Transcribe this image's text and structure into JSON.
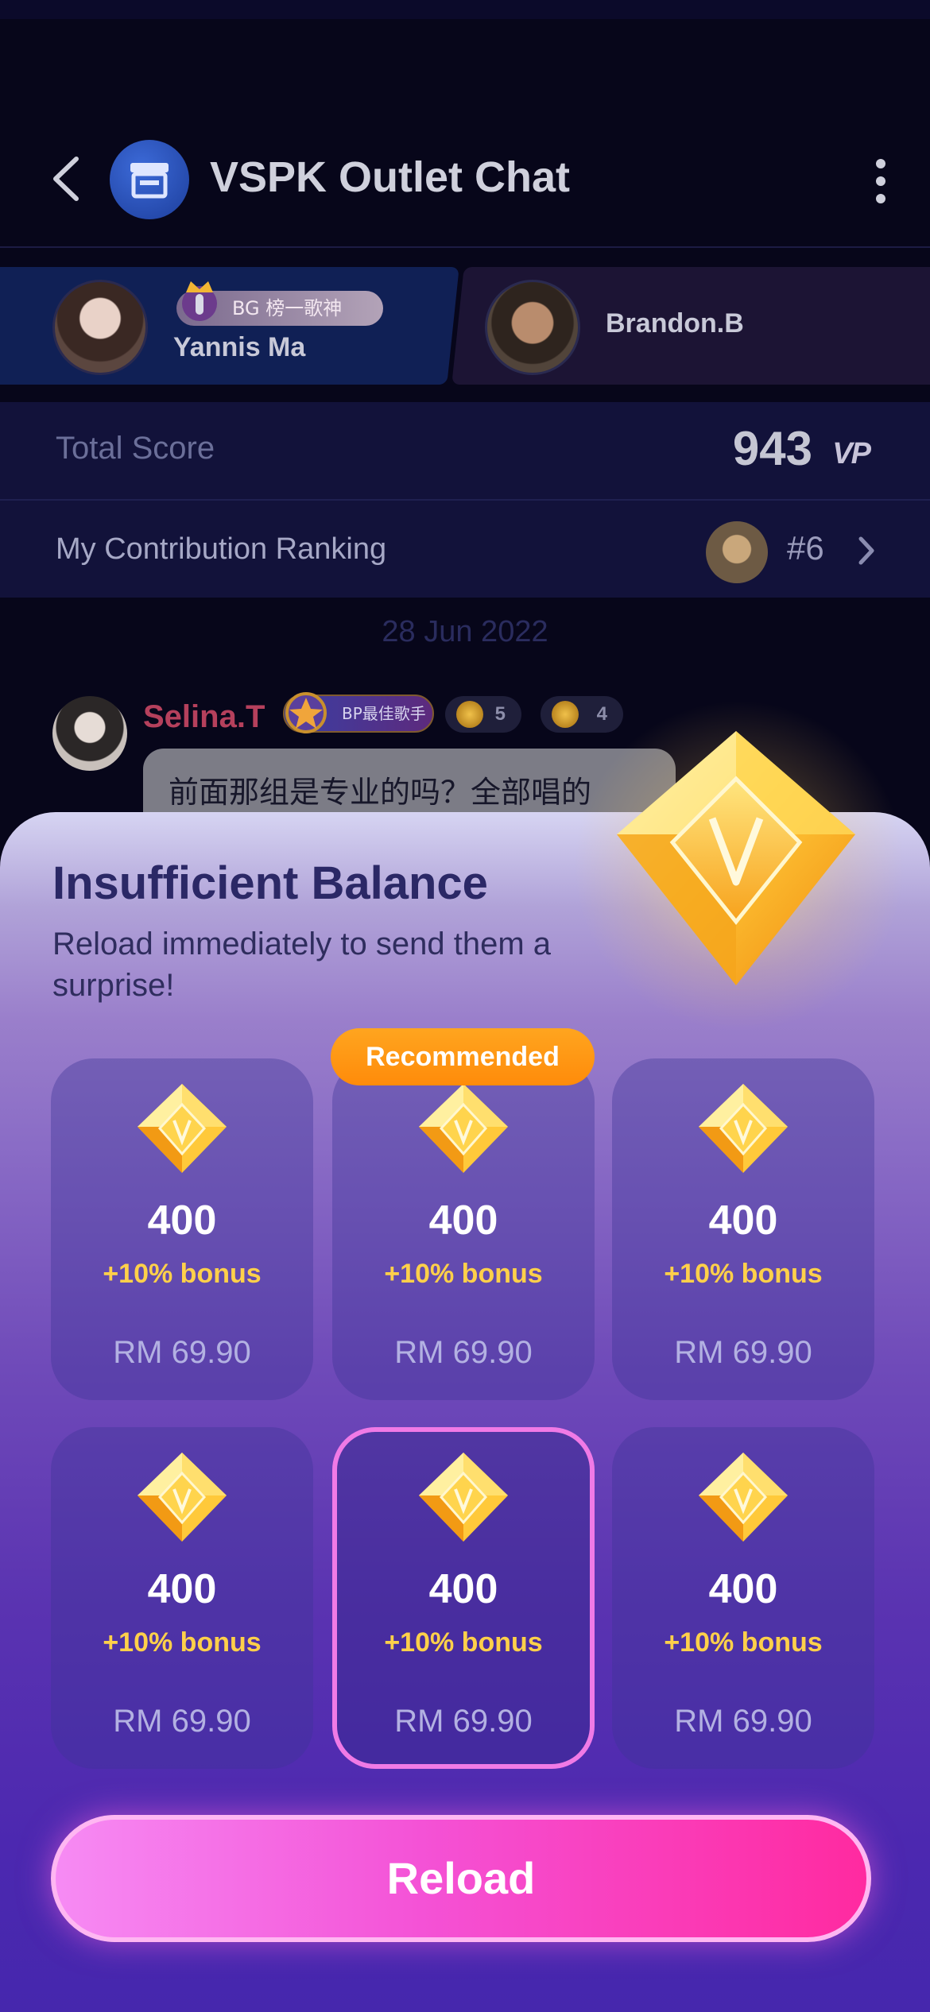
{
  "header": {
    "title": "VSPK Outlet Chat"
  },
  "singers": {
    "left": {
      "name": "Yannis Ma",
      "badge": "BG 榜一歌神"
    },
    "right": {
      "name": "Brandon.B"
    }
  },
  "score": {
    "label": "Total Score",
    "value": "943",
    "unit_logo": "VP"
  },
  "ranking": {
    "label": "My Contribution Ranking",
    "value": "#6"
  },
  "chat": {
    "date": "28 Jun 2022",
    "message": {
      "sender": "Selina.T",
      "badge": "BP最佳歌手",
      "level_a": "5",
      "level_b": "4",
      "text": "前面那组是专业的吗？全部唱的"
    }
  },
  "sheet": {
    "title": "Insufficient Balance",
    "subtitle": "Reload immediately to send them a surprise!",
    "recommended_label": "Recommended",
    "packages": [
      {
        "amount": "400",
        "bonus": "+10% bonus",
        "price": "RM 69.90"
      },
      {
        "amount": "400",
        "bonus": "+10% bonus",
        "price": "RM 69.90"
      },
      {
        "amount": "400",
        "bonus": "+10% bonus",
        "price": "RM 69.90"
      },
      {
        "amount": "400",
        "bonus": "+10% bonus",
        "price": "RM 69.90"
      },
      {
        "amount": "400",
        "bonus": "+10% bonus",
        "price": "RM 69.90"
      },
      {
        "amount": "400",
        "bonus": "+10% bonus",
        "price": "RM 69.90"
      }
    ],
    "reload_label": "Reload"
  },
  "colors": {
    "accent_pink": "#f452d6",
    "bonus_yellow": "#ffd04a",
    "recommended_orange": "#ff9a14",
    "title_navy": "#2b2866",
    "sender_red": "#b5405c"
  },
  "icons": {
    "back": "chevron-left-icon",
    "room": "store-icon",
    "menu": "more-vertical-icon",
    "gem": "diamond-gem-icon",
    "rank_more": "chevron-right-icon"
  }
}
